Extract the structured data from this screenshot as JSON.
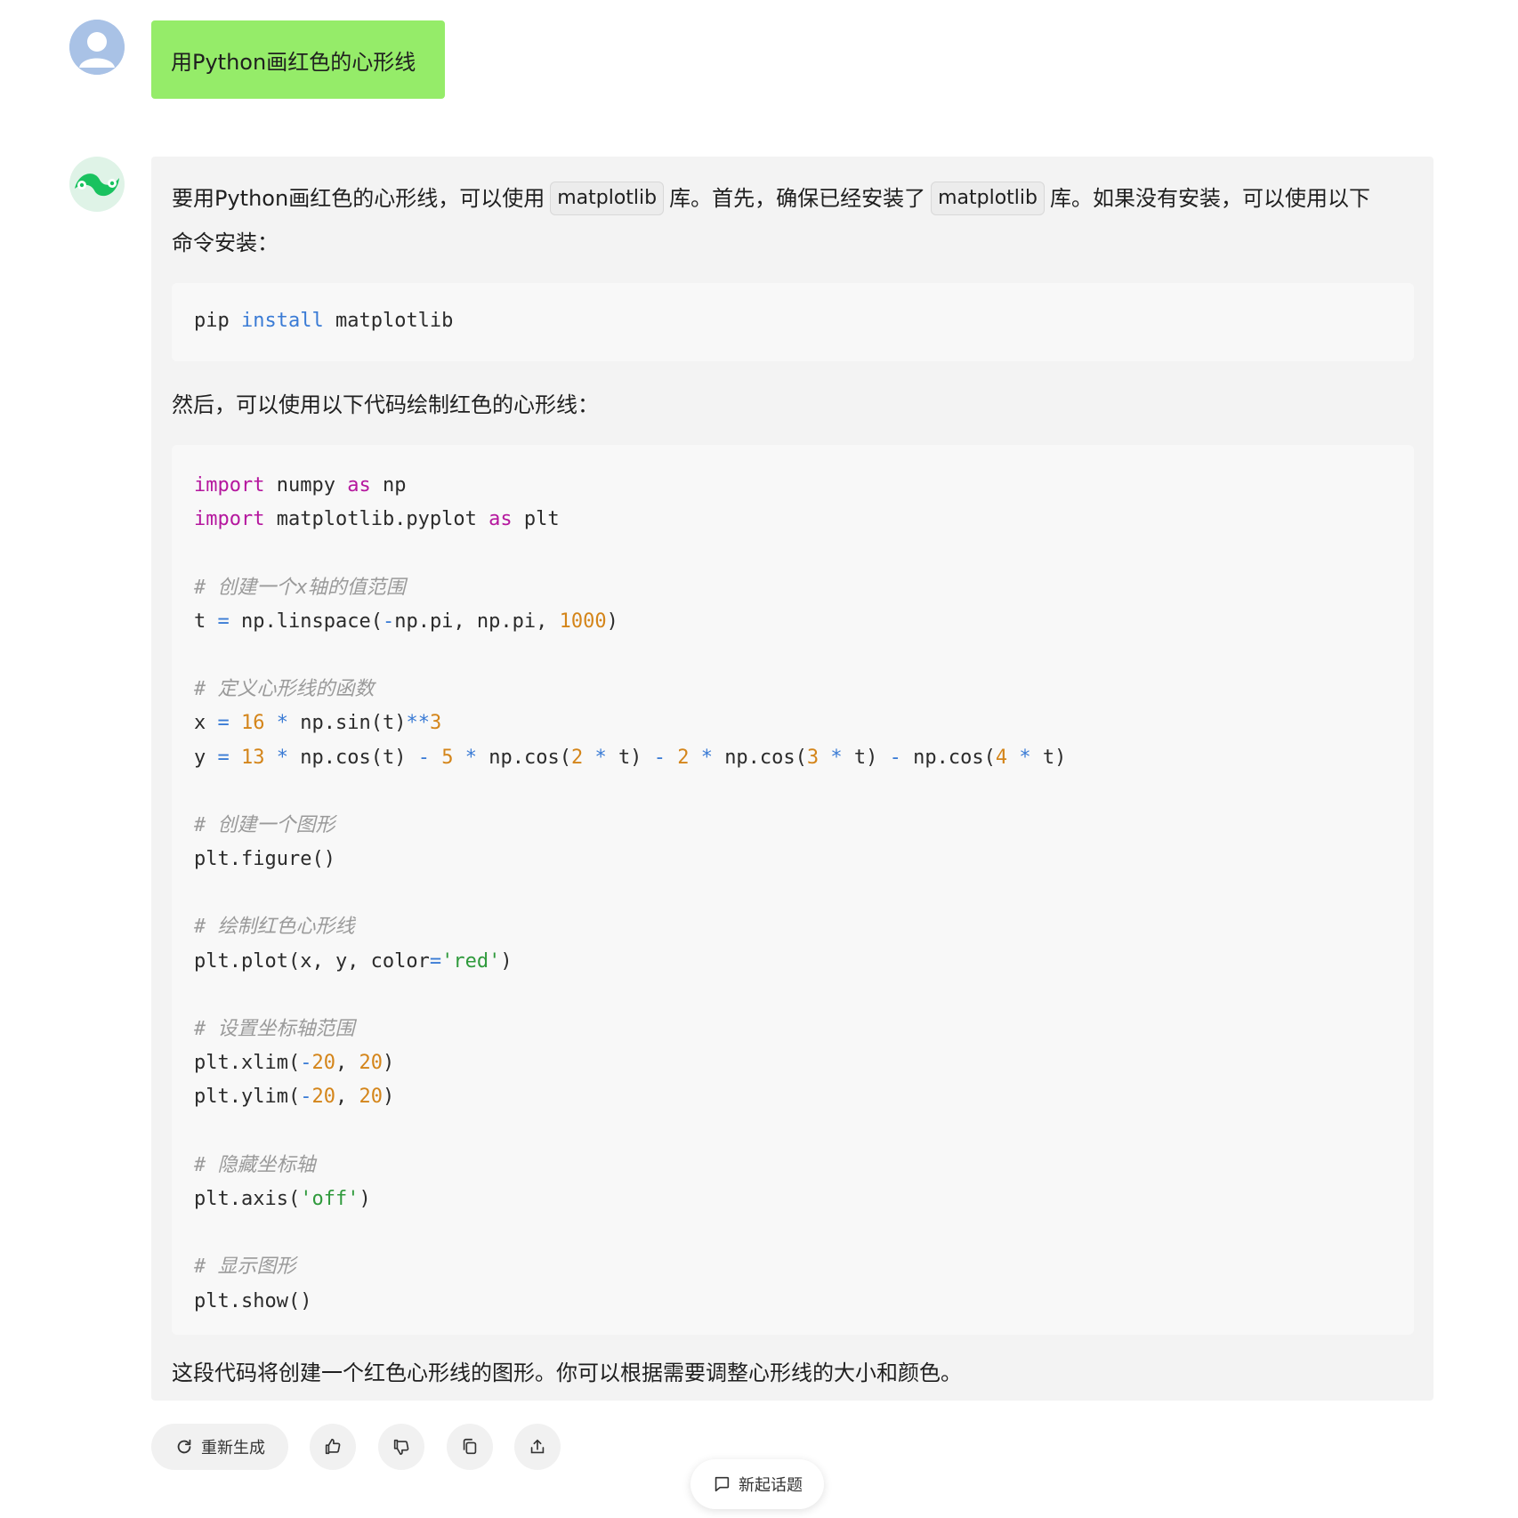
{
  "user_message": {
    "text": "用Python画红色的心形线",
    "bubble_color": "#95ec69"
  },
  "bot_message": {
    "intro_before_code1": "要用Python画红色的心形线，可以使用",
    "inline_code_1": "matplotlib",
    "intro_middle": "库。首先，确保已经安装了",
    "inline_code_2": "matplotlib",
    "intro_after": "库。如果没有安装，可以使用以下",
    "intro_line2": "命令安装：",
    "install_code": {
      "pip": "pip",
      "install": "install",
      "pkg": "matplotlib"
    },
    "then_text": "然后，可以使用以下代码绘制红色的心形线：",
    "code": {
      "l1_kw": "import",
      "l1_mod": "numpy",
      "l1_as": "as",
      "l1_alias": "np",
      "l2_kw": "import",
      "l2_mod": "matplotlib.pyplot",
      "l2_as": "as",
      "l2_alias": "plt",
      "c1": "# 创建一个x轴的值范围",
      "t_line": {
        "a": "t",
        "eq": "=",
        "b": "np.linspace(",
        "neg": "-",
        "c": "np.pi, np.pi, ",
        "n": "1000",
        "d": ")"
      },
      "c2": "# 定义心形线的函数",
      "x_line": {
        "a": "x",
        "eq": "=",
        "n1": "16",
        "mul": "*",
        "b": "np.sin(t)",
        "pow": "**",
        "n2": "3"
      },
      "y_line": {
        "a": "y",
        "eq": "=",
        "n1": "13",
        "mul1": "*",
        "b": "np.cos(t)",
        "m1": "-",
        "n2": "5",
        "mul2": "*",
        "c": "np.cos(",
        "n3": "2",
        "mul3": "*",
        "d": "t)",
        "m2": "-",
        "n4": "2",
        "mul4": "*",
        "e": "np.cos(",
        "n5": "3",
        "mul5": "*",
        "f": "t)",
        "m3": "-",
        "g": "np.cos(",
        "n6": "4",
        "mul6": "*",
        "h": "t)"
      },
      "c3": "# 创建一个图形",
      "fig": "plt.figure()",
      "c4": "# 绘制红色心形线",
      "plot": {
        "a": "plt.plot(x, y, color",
        "eq": "=",
        "s": "'red'",
        "b": ")"
      },
      "c5": "# 设置坐标轴范围",
      "xlim": {
        "a": "plt.xlim(",
        "neg": "-",
        "n1": "20",
        "sep": ", ",
        "n2": "20",
        "b": ")"
      },
      "ylim": {
        "a": "plt.ylim(",
        "neg": "-",
        "n1": "20",
        "sep": ", ",
        "n2": "20",
        "b": ")"
      },
      "c6": "# 隐藏坐标轴",
      "axis": {
        "a": "plt.axis(",
        "s": "'off'",
        "b": ")"
      },
      "c7": "# 显示图形",
      "show": "plt.show()"
    },
    "closing": "这段代码将创建一个红色心形线的图形。你可以根据需要调整心形线的大小和颜色。"
  },
  "actions": {
    "regenerate_label": "重新生成",
    "icons": [
      "thumbs-up-icon",
      "thumbs-down-icon",
      "copy-icon",
      "share-icon"
    ]
  },
  "new_topic_label": "新起话题"
}
